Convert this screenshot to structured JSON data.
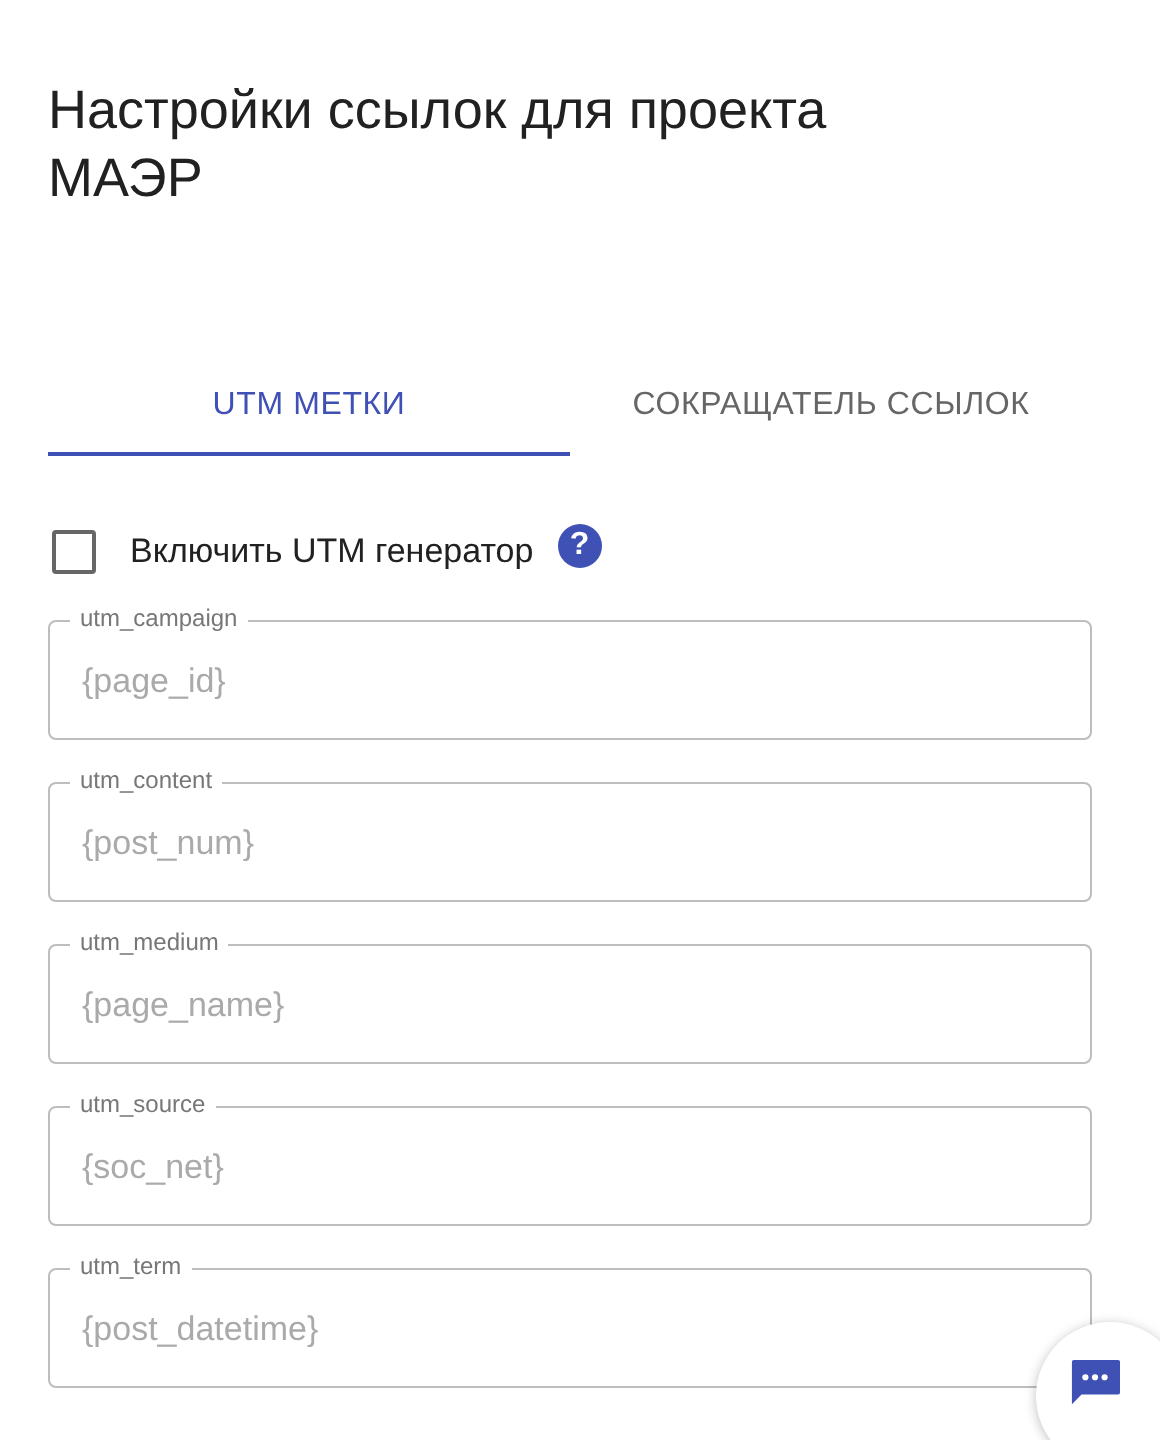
{
  "title": "Настройки ссылок для проекта МАЭР",
  "tabs": [
    {
      "label": "UTM МЕТКИ",
      "selected": true
    },
    {
      "label": "СОКРАЩАТЕЛЬ ССЫЛОК",
      "selected": false
    }
  ],
  "utm_toggle": {
    "label": "Включить UTM генератор",
    "checked": false,
    "help": "?"
  },
  "fields": [
    {
      "label": "utm_campaign",
      "placeholder": "{page_id}"
    },
    {
      "label": "utm_content",
      "placeholder": "{post_num}"
    },
    {
      "label": "utm_medium",
      "placeholder": "{page_name}"
    },
    {
      "label": "utm_source",
      "placeholder": "{soc_net}"
    },
    {
      "label": "utm_term",
      "placeholder": "{post_datetime}"
    }
  ]
}
